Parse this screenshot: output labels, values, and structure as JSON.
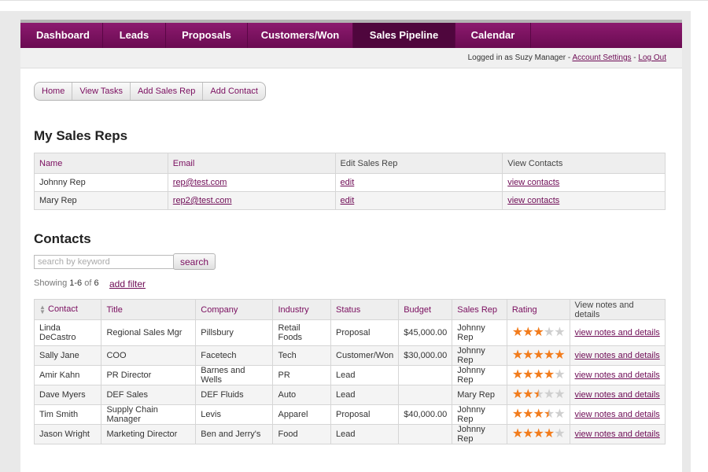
{
  "nav": {
    "items": [
      {
        "label": "Dashboard",
        "active": false
      },
      {
        "label": "Leads",
        "active": false
      },
      {
        "label": "Proposals",
        "active": false
      },
      {
        "label": "Customers/Won",
        "active": false
      },
      {
        "label": "Sales Pipeline",
        "active": true
      },
      {
        "label": "Calendar",
        "active": false
      }
    ],
    "accent": "#7a0e5f"
  },
  "loginbar": {
    "text": "Logged in as Suzy Manager - ",
    "account_settings": "Account Settings",
    "sep": " - ",
    "logout": "Log Out"
  },
  "subnav": [
    "Home",
    "View Tasks",
    "Add Sales Rep",
    "Add Contact"
  ],
  "reps": {
    "title": "My Sales Reps",
    "headers": [
      "Name",
      "Email",
      "Edit Sales Rep",
      "View Contacts"
    ],
    "rows": [
      {
        "name": "Johnny Rep",
        "email": "rep@test.com",
        "edit": "edit",
        "view": "view contacts"
      },
      {
        "name": "Mary Rep",
        "email": "rep2@test.com",
        "edit": "edit",
        "view": "view contacts"
      }
    ]
  },
  "contacts": {
    "title": "Contacts",
    "search_placeholder": "search by keyword",
    "search_button": "search",
    "showing_prefix": "Showing ",
    "showing_range": "1-6",
    "showing_of": " of ",
    "showing_total": "6",
    "add_filter": "add filter",
    "headers": [
      "Contact",
      "Title",
      "Company",
      "Industry",
      "Status",
      "Budget",
      "Sales Rep",
      "Rating",
      "View notes and details"
    ],
    "rows": [
      {
        "contact": "Linda DeCastro",
        "title": "Regional Sales Mgr",
        "company": "Pillsbury",
        "industry": "Retail Foods",
        "status": "Proposal",
        "budget": "$45,000.00",
        "rep": "Johnny Rep",
        "rating": 3,
        "notes": "view notes and details"
      },
      {
        "contact": "Sally Jane",
        "title": "COO",
        "company": "Facetech",
        "industry": "Tech",
        "status": "Customer/Won",
        "budget": "$30,000.00",
        "rep": "Johnny Rep",
        "rating": 5,
        "notes": "view notes and details"
      },
      {
        "contact": "Amir Kahn",
        "title": "PR Director",
        "company": "Barnes and Wells",
        "industry": "PR",
        "status": "Lead",
        "budget": "",
        "rep": "Johnny Rep",
        "rating": 4,
        "notes": "view notes and details"
      },
      {
        "contact": "Dave Myers",
        "title": "DEF Sales",
        "company": "DEF Fluids",
        "industry": "Auto",
        "status": "Lead",
        "budget": "",
        "rep": "Mary Rep",
        "rating": 2.5,
        "notes": "view notes and details"
      },
      {
        "contact": "Tim Smith",
        "title": "Supply Chain Manager",
        "company": "Levis",
        "industry": "Apparel",
        "status": "Proposal",
        "budget": "$40,000.00",
        "rep": "Johnny Rep",
        "rating": 3.5,
        "notes": "view notes and details"
      },
      {
        "contact": "Jason Wright",
        "title": "Marketing Director",
        "company": "Ben and Jerry's",
        "industry": "Food",
        "status": "Lead",
        "budget": "",
        "rep": "Johnny Rep",
        "rating": 4,
        "notes": "view notes and details"
      }
    ]
  }
}
